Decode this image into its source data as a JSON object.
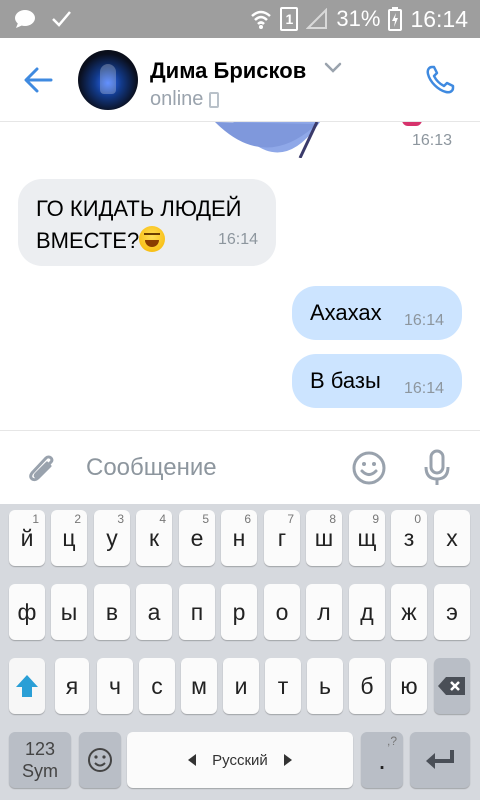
{
  "status_bar": {
    "battery_percent": "31%",
    "time": "16:14",
    "sim_label": "1"
  },
  "header": {
    "contact_name": "Дима Брисков",
    "status": "online"
  },
  "chat": {
    "sticker_time": "16:13",
    "messages": [
      {
        "direction": "incoming",
        "text": "ГО КИДАТЬ ЛЮДЕЙ ВМЕСТЕ?",
        "emoji": "grinning-squinting-face",
        "time": "16:14"
      },
      {
        "direction": "outgoing",
        "text": "Ахахах",
        "time": "16:14"
      },
      {
        "direction": "outgoing",
        "text": "В базы",
        "time": "16:14"
      }
    ]
  },
  "composer": {
    "placeholder": "Сообщение"
  },
  "keyboard": {
    "row1": [
      "й",
      "ц",
      "у",
      "к",
      "е",
      "н",
      "г",
      "ш",
      "щ",
      "з",
      "х"
    ],
    "row1_hints": [
      "1",
      "2",
      "3",
      "4",
      "5",
      "6",
      "7",
      "8",
      "9",
      "0",
      ""
    ],
    "row2": [
      "ф",
      "ы",
      "в",
      "а",
      "п",
      "р",
      "о",
      "л",
      "д",
      "ж",
      "э"
    ],
    "row3": [
      "я",
      "ч",
      "с",
      "м",
      "и",
      "т",
      "ь",
      "б",
      "ю"
    ],
    "sym_label_top": "123",
    "sym_label_bottom": "Sym",
    "space_label": "Русский",
    "period_key": ".",
    "period_hint": ",?"
  },
  "colors": {
    "accent": "#3f8ae0",
    "incoming_bubble": "#eceef1",
    "outgoing_bubble": "#cce4ff",
    "status_bar": "#9e9e9e",
    "keyboard_bg": "#d6d9de",
    "shift_arrow": "#2a9fd6"
  }
}
